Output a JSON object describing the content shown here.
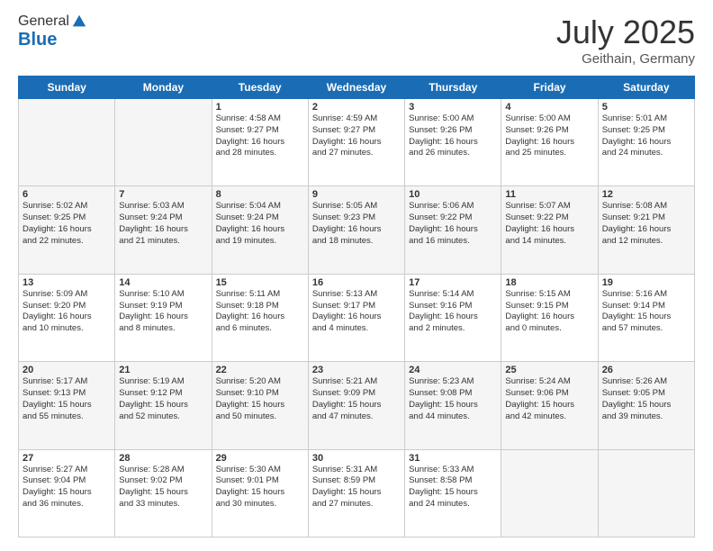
{
  "header": {
    "logo_general": "General",
    "logo_blue": "Blue",
    "month_year": "July 2025",
    "location": "Geithain, Germany"
  },
  "days_of_week": [
    "Sunday",
    "Monday",
    "Tuesday",
    "Wednesday",
    "Thursday",
    "Friday",
    "Saturday"
  ],
  "weeks": [
    [
      {
        "day": "",
        "info": ""
      },
      {
        "day": "",
        "info": ""
      },
      {
        "day": "1",
        "info": "Sunrise: 4:58 AM\nSunset: 9:27 PM\nDaylight: 16 hours\nand 28 minutes."
      },
      {
        "day": "2",
        "info": "Sunrise: 4:59 AM\nSunset: 9:27 PM\nDaylight: 16 hours\nand 27 minutes."
      },
      {
        "day": "3",
        "info": "Sunrise: 5:00 AM\nSunset: 9:26 PM\nDaylight: 16 hours\nand 26 minutes."
      },
      {
        "day": "4",
        "info": "Sunrise: 5:00 AM\nSunset: 9:26 PM\nDaylight: 16 hours\nand 25 minutes."
      },
      {
        "day": "5",
        "info": "Sunrise: 5:01 AM\nSunset: 9:25 PM\nDaylight: 16 hours\nand 24 minutes."
      }
    ],
    [
      {
        "day": "6",
        "info": "Sunrise: 5:02 AM\nSunset: 9:25 PM\nDaylight: 16 hours\nand 22 minutes."
      },
      {
        "day": "7",
        "info": "Sunrise: 5:03 AM\nSunset: 9:24 PM\nDaylight: 16 hours\nand 21 minutes."
      },
      {
        "day": "8",
        "info": "Sunrise: 5:04 AM\nSunset: 9:24 PM\nDaylight: 16 hours\nand 19 minutes."
      },
      {
        "day": "9",
        "info": "Sunrise: 5:05 AM\nSunset: 9:23 PM\nDaylight: 16 hours\nand 18 minutes."
      },
      {
        "day": "10",
        "info": "Sunrise: 5:06 AM\nSunset: 9:22 PM\nDaylight: 16 hours\nand 16 minutes."
      },
      {
        "day": "11",
        "info": "Sunrise: 5:07 AM\nSunset: 9:22 PM\nDaylight: 16 hours\nand 14 minutes."
      },
      {
        "day": "12",
        "info": "Sunrise: 5:08 AM\nSunset: 9:21 PM\nDaylight: 16 hours\nand 12 minutes."
      }
    ],
    [
      {
        "day": "13",
        "info": "Sunrise: 5:09 AM\nSunset: 9:20 PM\nDaylight: 16 hours\nand 10 minutes."
      },
      {
        "day": "14",
        "info": "Sunrise: 5:10 AM\nSunset: 9:19 PM\nDaylight: 16 hours\nand 8 minutes."
      },
      {
        "day": "15",
        "info": "Sunrise: 5:11 AM\nSunset: 9:18 PM\nDaylight: 16 hours\nand 6 minutes."
      },
      {
        "day": "16",
        "info": "Sunrise: 5:13 AM\nSunset: 9:17 PM\nDaylight: 16 hours\nand 4 minutes."
      },
      {
        "day": "17",
        "info": "Sunrise: 5:14 AM\nSunset: 9:16 PM\nDaylight: 16 hours\nand 2 minutes."
      },
      {
        "day": "18",
        "info": "Sunrise: 5:15 AM\nSunset: 9:15 PM\nDaylight: 16 hours\nand 0 minutes."
      },
      {
        "day": "19",
        "info": "Sunrise: 5:16 AM\nSunset: 9:14 PM\nDaylight: 15 hours\nand 57 minutes."
      }
    ],
    [
      {
        "day": "20",
        "info": "Sunrise: 5:17 AM\nSunset: 9:13 PM\nDaylight: 15 hours\nand 55 minutes."
      },
      {
        "day": "21",
        "info": "Sunrise: 5:19 AM\nSunset: 9:12 PM\nDaylight: 15 hours\nand 52 minutes."
      },
      {
        "day": "22",
        "info": "Sunrise: 5:20 AM\nSunset: 9:10 PM\nDaylight: 15 hours\nand 50 minutes."
      },
      {
        "day": "23",
        "info": "Sunrise: 5:21 AM\nSunset: 9:09 PM\nDaylight: 15 hours\nand 47 minutes."
      },
      {
        "day": "24",
        "info": "Sunrise: 5:23 AM\nSunset: 9:08 PM\nDaylight: 15 hours\nand 44 minutes."
      },
      {
        "day": "25",
        "info": "Sunrise: 5:24 AM\nSunset: 9:06 PM\nDaylight: 15 hours\nand 42 minutes."
      },
      {
        "day": "26",
        "info": "Sunrise: 5:26 AM\nSunset: 9:05 PM\nDaylight: 15 hours\nand 39 minutes."
      }
    ],
    [
      {
        "day": "27",
        "info": "Sunrise: 5:27 AM\nSunset: 9:04 PM\nDaylight: 15 hours\nand 36 minutes."
      },
      {
        "day": "28",
        "info": "Sunrise: 5:28 AM\nSunset: 9:02 PM\nDaylight: 15 hours\nand 33 minutes."
      },
      {
        "day": "29",
        "info": "Sunrise: 5:30 AM\nSunset: 9:01 PM\nDaylight: 15 hours\nand 30 minutes."
      },
      {
        "day": "30",
        "info": "Sunrise: 5:31 AM\nSunset: 8:59 PM\nDaylight: 15 hours\nand 27 minutes."
      },
      {
        "day": "31",
        "info": "Sunrise: 5:33 AM\nSunset: 8:58 PM\nDaylight: 15 hours\nand 24 minutes."
      },
      {
        "day": "",
        "info": ""
      },
      {
        "day": "",
        "info": ""
      }
    ]
  ]
}
